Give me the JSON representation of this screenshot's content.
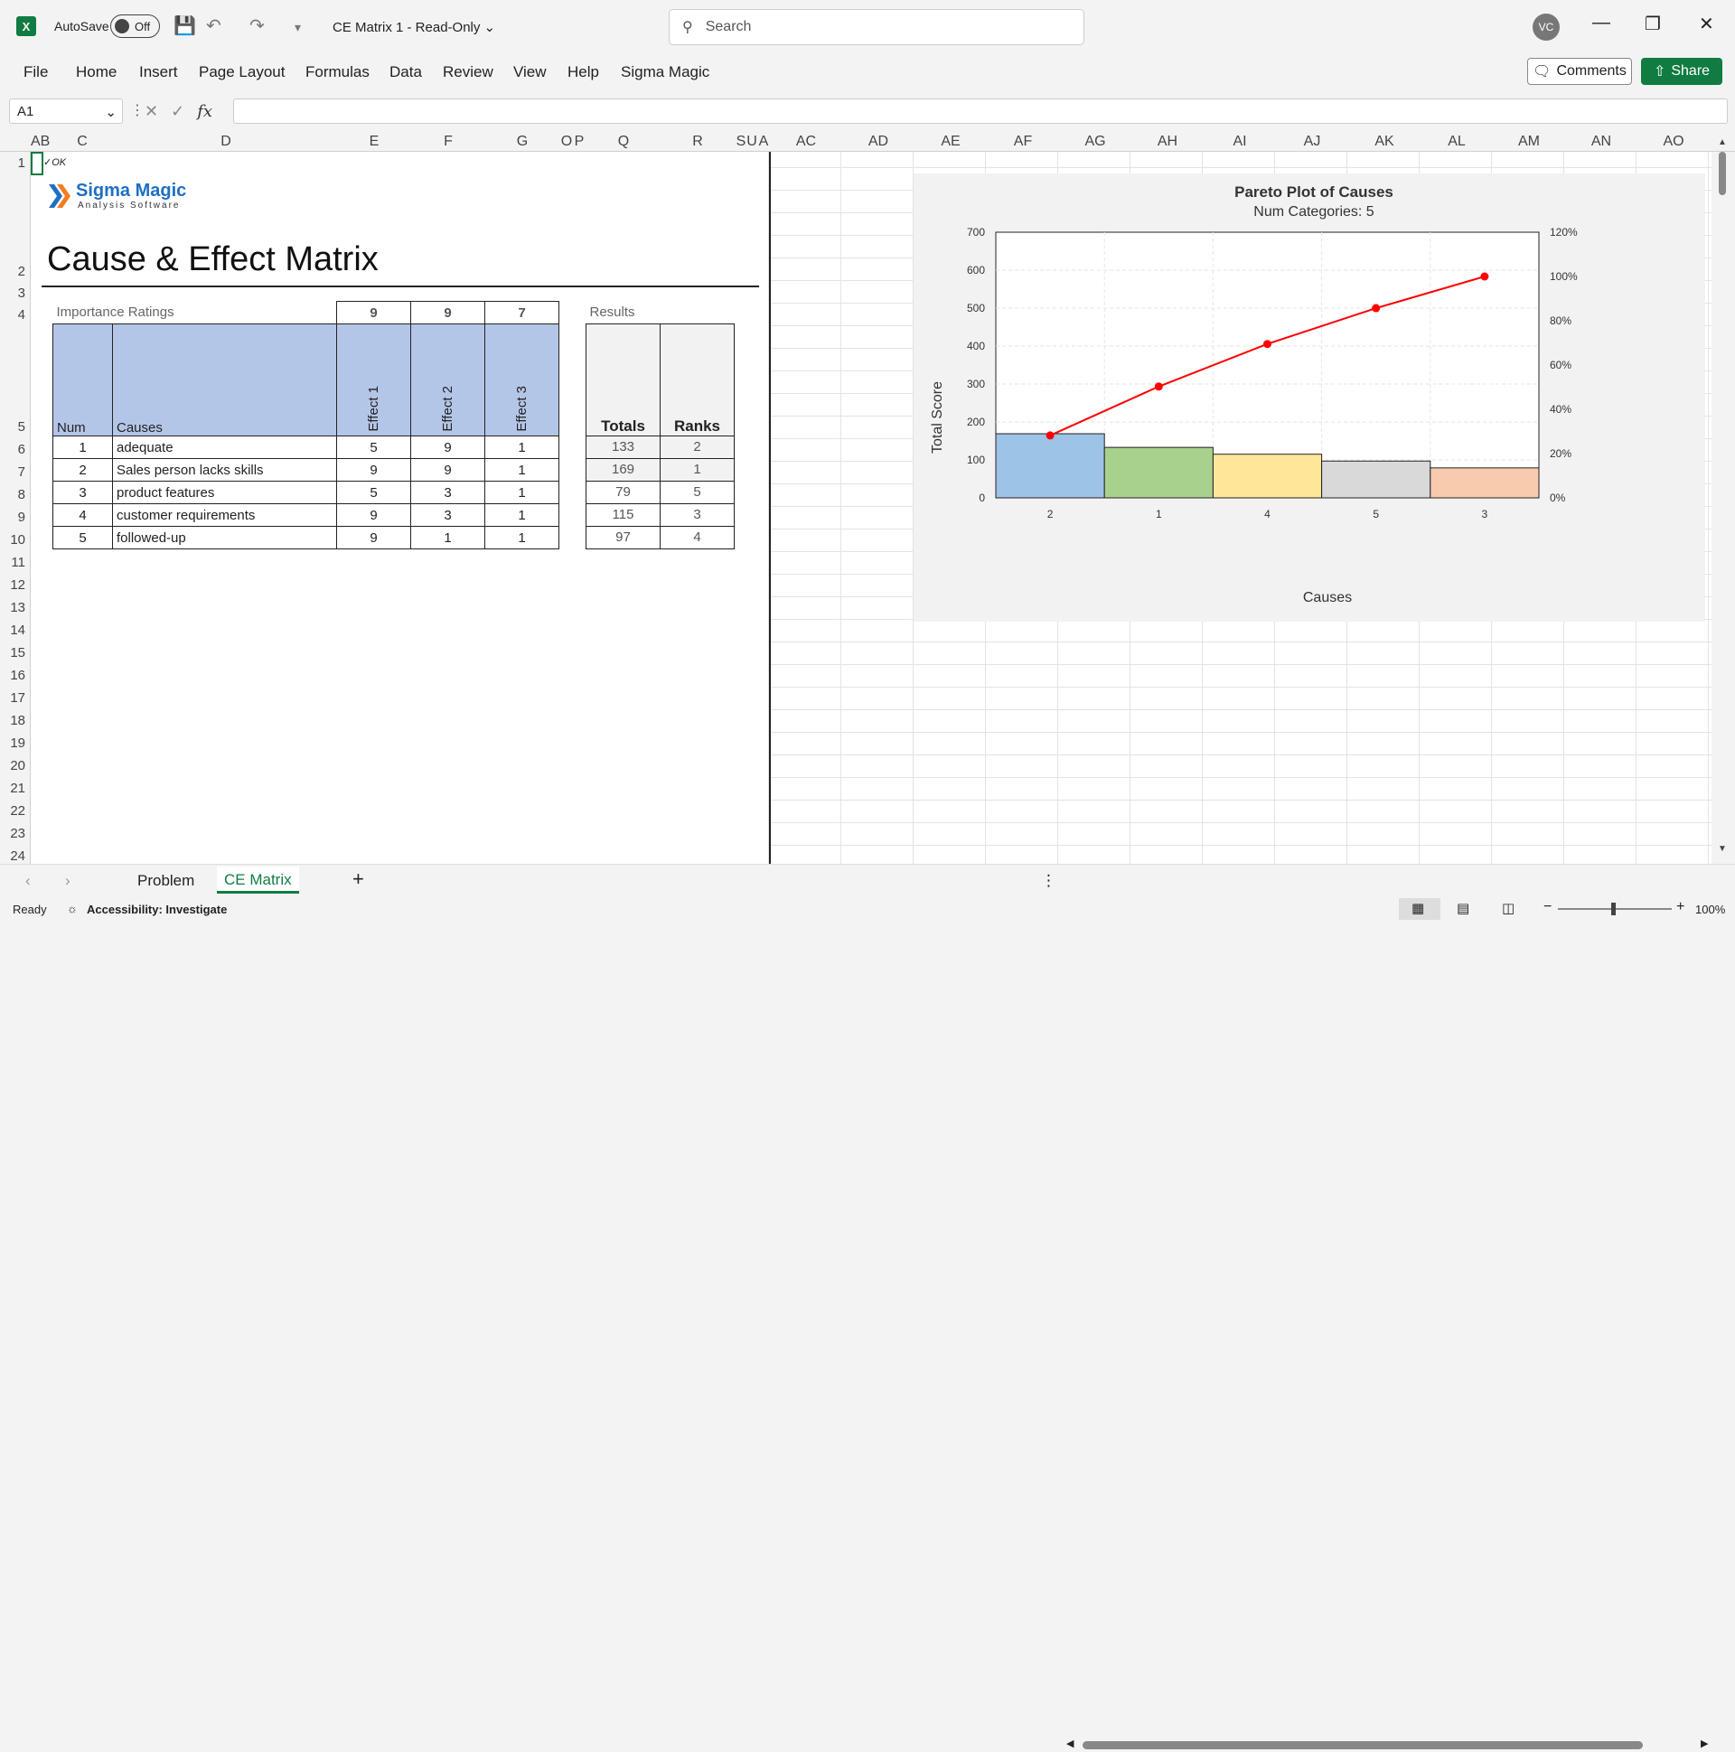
{
  "titlebar": {
    "autosave_label": "AutoSave",
    "autosave_state": "Off",
    "doc_title": "CE Matrix 1  -  Read-Only",
    "search_placeholder": "Search",
    "user_initials": "VC"
  },
  "menu": [
    "File",
    "Home",
    "Insert",
    "Page Layout",
    "Formulas",
    "Data",
    "Review",
    "View",
    "Help",
    "Sigma Magic"
  ],
  "ribbon_right": {
    "comments": "Comments",
    "share": "Share"
  },
  "formula_bar": {
    "name_box": "A1",
    "fx": "fx",
    "formula": ""
  },
  "columns": [
    "A",
    "B",
    "C",
    "D",
    "E",
    "F",
    "G",
    "O",
    "P",
    "Q",
    "R",
    "S",
    "U",
    "A",
    "AC",
    "AD",
    "AE",
    "AF",
    "AG",
    "AH",
    "AI",
    "AJ",
    "AK",
    "AL",
    "AM",
    "AN",
    "AO"
  ],
  "rows": [
    "1",
    "2",
    "3",
    "4",
    "5",
    "6",
    "7",
    "8",
    "9",
    "10",
    "11",
    "12",
    "13",
    "14",
    "15",
    "16",
    "17",
    "18",
    "19",
    "20",
    "21",
    "22",
    "23",
    "24"
  ],
  "sheet": {
    "ok_mark": "✓OK",
    "logo_main": "Sigma Magic",
    "logo_sub": "Analysis Software",
    "title": "Cause & Effect Matrix",
    "importance_label": "Importance Ratings",
    "ratings": [
      "9",
      "9",
      "7"
    ],
    "results_label": "Results",
    "headers": {
      "num": "Num",
      "causes": "Causes",
      "effects": [
        "Effect 1",
        "Effect 2",
        "Effect 3"
      ],
      "totals": "Totals",
      "ranks": "Ranks"
    },
    "rows": [
      {
        "num": "1",
        "cause": "adequate",
        "e1": "5",
        "e2": "9",
        "e3": "1",
        "total": "133",
        "rank": "2"
      },
      {
        "num": "2",
        "cause": "Sales person lacks skills",
        "e1": "9",
        "e2": "9",
        "e3": "1",
        "total": "169",
        "rank": "1"
      },
      {
        "num": "3",
        "cause": "product features",
        "e1": "5",
        "e2": "3",
        "e3": "1",
        "total": "79",
        "rank": "5"
      },
      {
        "num": "4",
        "cause": "customer requirements",
        "e1": "9",
        "e2": "3",
        "e3": "1",
        "total": "115",
        "rank": "3"
      },
      {
        "num": "5",
        "cause": "followed-up",
        "e1": "9",
        "e2": "1",
        "e3": "1",
        "total": "97",
        "rank": "4"
      }
    ]
  },
  "chart_data": {
    "type": "bar",
    "title": "Pareto Plot of Causes",
    "subtitle": "Num Categories: 5",
    "xlabel": "Causes",
    "ylabel": "Total Score",
    "categories": [
      "2",
      "1",
      "4",
      "5",
      "3"
    ],
    "series": [
      {
        "name": "Total Score",
        "values": [
          169,
          133,
          115,
          97,
          79
        ],
        "colors": [
          "#9dc3e6",
          "#a9d18e",
          "#ffe699",
          "#d9d9d9",
          "#f8cbad"
        ]
      },
      {
        "values": [
          28.2,
          50.3,
          69.5,
          85.7,
          100.0
        ],
        "color": "#ff0000",
        "type": "line",
        "axis": "right"
      }
    ],
    "ylim": [
      0,
      700
    ],
    "y_ticks": [
      "0",
      "100",
      "200",
      "300",
      "400",
      "500",
      "600",
      "700"
    ],
    "y2lim": [
      0,
      120
    ],
    "y2_ticks": [
      "0%",
      "20%",
      "40%",
      "60%",
      "80%",
      "100%",
      "120%"
    ],
    "grid": true
  },
  "sheet_tabs": [
    "Problem",
    "CE Matrix"
  ],
  "active_tab": "CE Matrix",
  "status": {
    "ready": "Ready",
    "accessibility": "Accessibility: Investigate",
    "zoom": "100%"
  }
}
